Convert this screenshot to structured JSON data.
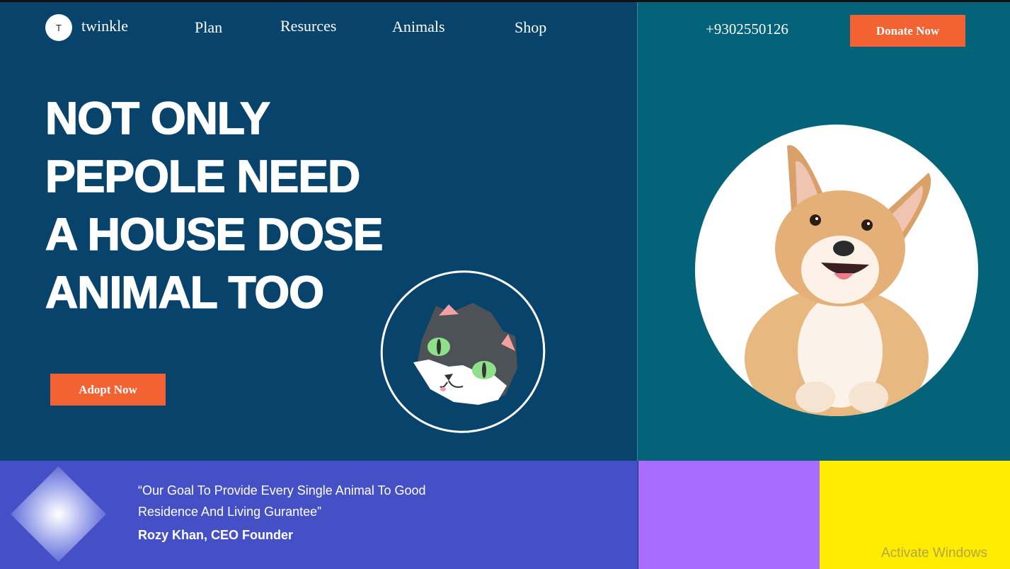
{
  "logo": {
    "initial": "T",
    "name": "twinkle"
  },
  "nav": {
    "items": [
      {
        "label": "Plan"
      },
      {
        "label": "Resurces"
      },
      {
        "label": "Animals"
      },
      {
        "label": "Shop"
      }
    ]
  },
  "header": {
    "phone": "+9302550126",
    "donate_label": "Donate Now"
  },
  "hero": {
    "lines": [
      "NOT ONLY",
      "PEPOLE NEED",
      "A HOUSE DOSE",
      "ANIMAL TOO"
    ],
    "adopt_label": "Adopt Now"
  },
  "testimonial": {
    "quote_line1": "“Our Goal To Provide Every Single Animal To Good",
    "quote_line2": "Residence And Living Gurantee”",
    "author": "Rozy Khan, CEO Founder"
  },
  "watermark": {
    "text": "Activate Windows"
  },
  "colors": {
    "navy": "#07436a",
    "teal": "#046379",
    "accent_orange": "#f26233",
    "indigo": "#4650c6",
    "purple": "#a86cff",
    "yellow": "#ffec00"
  }
}
